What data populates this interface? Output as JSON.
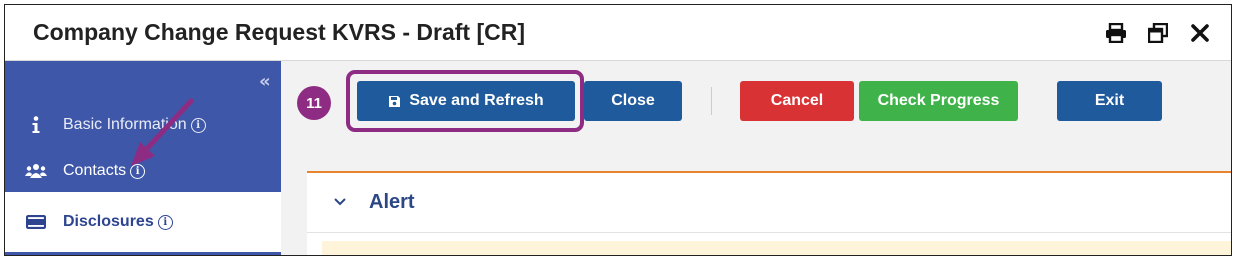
{
  "window": {
    "title": "Company Change Request KVRS - Draft [CR]",
    "icons": [
      "print-icon",
      "restore-window-icon",
      "close-icon"
    ]
  },
  "sidebar": {
    "collapse_glyph": "«",
    "items": [
      {
        "label": "Basic Information",
        "icon": "info-icon",
        "active": false
      },
      {
        "label": "Contacts",
        "icon": "users-icon",
        "active": false
      },
      {
        "label": "Disclosures",
        "icon": "card-icon",
        "active": true
      }
    ]
  },
  "toolbar": {
    "step_number": "11",
    "save_label": "Save and Refresh",
    "close_label": "Close",
    "cancel_label": "Cancel",
    "check_progress_label": "Check Progress",
    "exit_label": "Exit"
  },
  "panel": {
    "title": "Alert"
  },
  "colors": {
    "sidebar": "#3f57a8",
    "primary_button": "#1f5a9c",
    "cancel_button": "#d83235",
    "progress_button": "#3fb349",
    "highlight": "#8e2c83",
    "panel_accent": "#e8832e"
  }
}
